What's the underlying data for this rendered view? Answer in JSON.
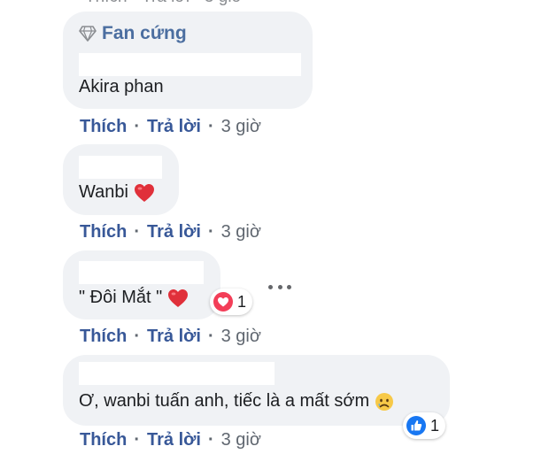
{
  "comments": [
    {
      "badge": "Fan cứng",
      "text": "Akira phan",
      "actions": {
        "like": "Thích",
        "reply": "Trả lời",
        "time": "3 giờ"
      }
    },
    {
      "text": "Wanbi",
      "emoji": "red-heart",
      "actions": {
        "like": "Thích",
        "reply": "Trả lời",
        "time": "3 giờ"
      }
    },
    {
      "text": "\" Đôi Mắt \"",
      "emoji": "red-heart",
      "reaction": {
        "icon": "love-reaction",
        "count": "1"
      },
      "actions": {
        "like": "Thích",
        "reply": "Trả lời",
        "time": "3 giờ"
      }
    },
    {
      "text": "Ơ, wanbi tuấn anh, tiếc là a mất sớm",
      "emoji": "sad-face",
      "reaction": {
        "icon": "like-reaction",
        "count": "1"
      },
      "actions": {
        "like": "Thích",
        "reply": "Trả lời",
        "time": "3 giờ"
      }
    }
  ],
  "separator": "·",
  "colors": {
    "bubble": "#f0f2f5",
    "link": "#385898",
    "badge": "#4b6ea0",
    "meta": "#606770",
    "love": "#f33e58",
    "like": "#1877f2"
  }
}
